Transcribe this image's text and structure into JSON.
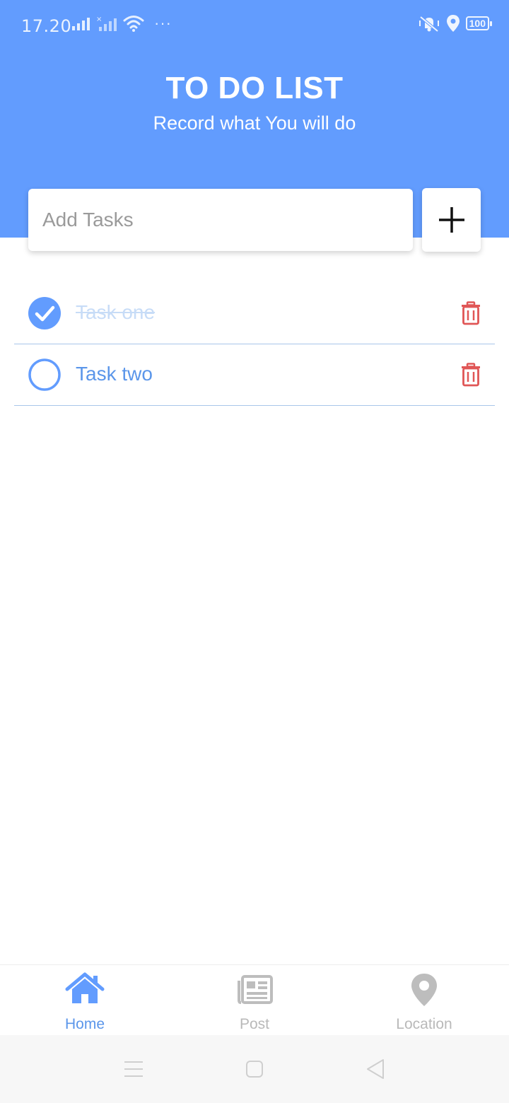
{
  "status_bar": {
    "time": "17.20",
    "battery": "100",
    "more": "···"
  },
  "header": {
    "title": "TO DO LIST",
    "subtitle": "Record what You will do"
  },
  "add_task": {
    "placeholder": "Add Tasks",
    "value": "",
    "add_icon": "plus-icon"
  },
  "tasks": [
    {
      "label": "Task one",
      "completed": true
    },
    {
      "label": "Task two",
      "completed": false
    }
  ],
  "bottom_nav": [
    {
      "label": "Home",
      "icon": "home-icon",
      "active": true
    },
    {
      "label": "Post",
      "icon": "newspaper-icon",
      "active": false
    },
    {
      "label": "Location",
      "icon": "map-pin-icon",
      "active": false
    }
  ],
  "colors": {
    "primary": "#629cfe",
    "task_text": "#5b96ea",
    "delete": "#e05656",
    "inactive": "#b9b9b9"
  }
}
